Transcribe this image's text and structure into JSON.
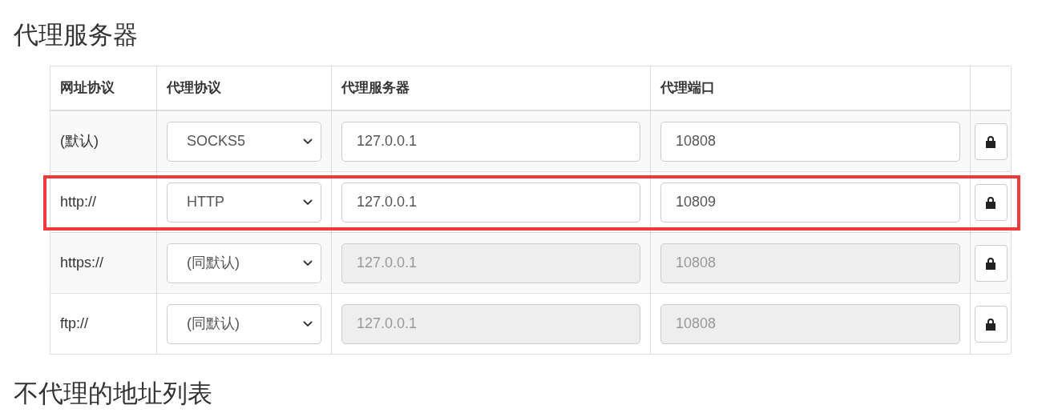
{
  "sections": [
    {
      "title": "代理服务器"
    },
    {
      "title": "不代理的地址列表"
    }
  ],
  "table": {
    "columns": [
      "网址协议",
      "代理协议",
      "代理服务器",
      "代理端口"
    ],
    "rows": [
      {
        "scheme": "(默认)",
        "protocol": "SOCKS5",
        "server": "127.0.0.1",
        "port": "10808",
        "disabled": false,
        "highlighted": false
      },
      {
        "scheme": "http://",
        "protocol": "HTTP",
        "server": "127.0.0.1",
        "port": "10809",
        "disabled": false,
        "highlighted": true
      },
      {
        "scheme": "https://",
        "protocol": "(同默认)",
        "server": "127.0.0.1",
        "port": "10808",
        "disabled": true,
        "highlighted": false
      },
      {
        "scheme": "ftp://",
        "protocol": "(同默认)",
        "server": "127.0.0.1",
        "port": "10808",
        "disabled": true,
        "highlighted": false
      }
    ]
  }
}
